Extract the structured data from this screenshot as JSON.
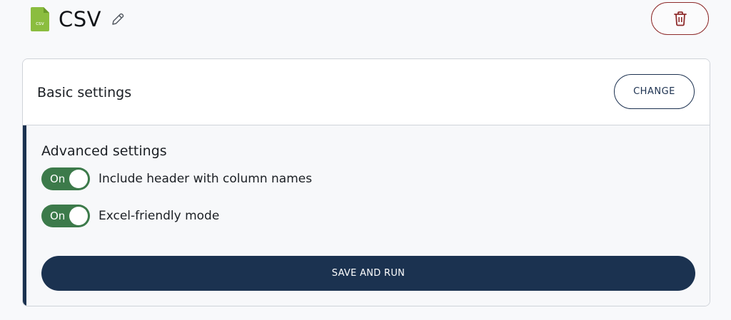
{
  "header": {
    "title": "CSV",
    "file_icon": "csv-file-icon",
    "file_icon_text": "csv",
    "file_icon_color": "#8bbd3f",
    "edit_icon": "pencil-icon",
    "delete_icon": "trash-icon",
    "delete_color": "#8e2b2b"
  },
  "basic": {
    "title": "Basic settings",
    "change_label": "CHANGE"
  },
  "advanced": {
    "title": "Advanced settings",
    "toggles": [
      {
        "state_label": "On",
        "label": "Include header with column names",
        "on": true
      },
      {
        "state_label": "On",
        "label": "Excel-friendly mode",
        "on": true
      }
    ],
    "save_label": "SAVE AND RUN"
  },
  "colors": {
    "accent": "#1b3250",
    "toggle_on": "#3c7a4a",
    "danger": "#8e2b2b"
  }
}
